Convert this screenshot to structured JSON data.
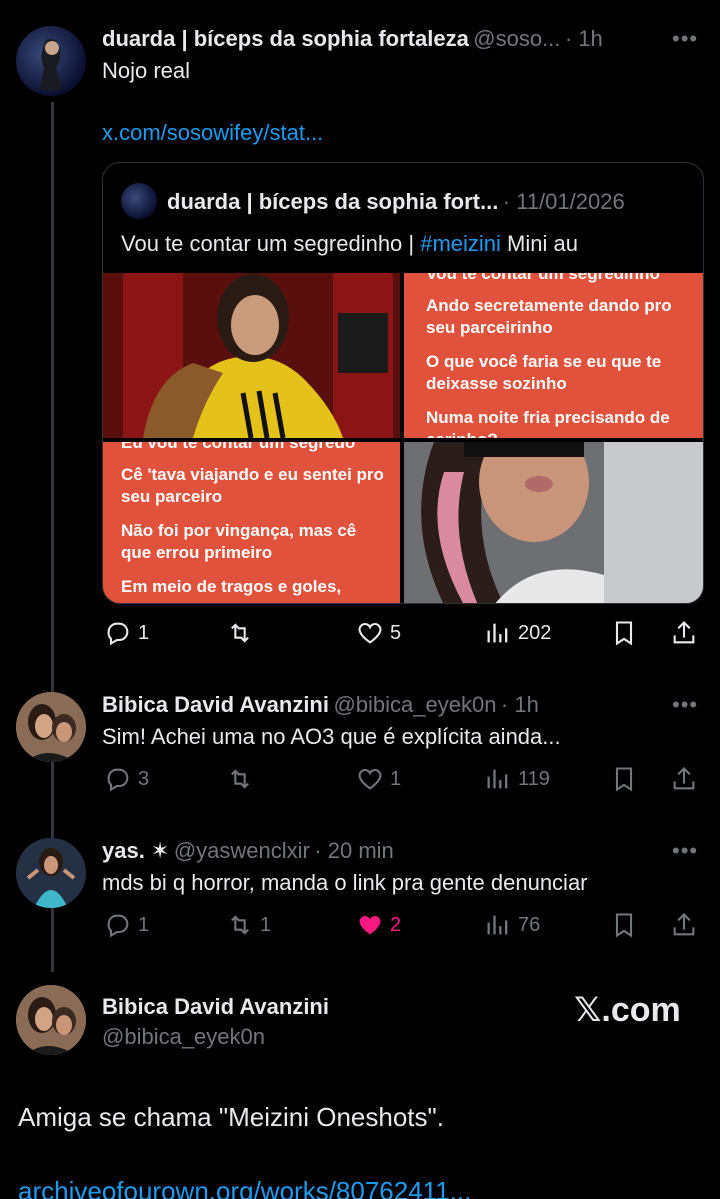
{
  "post1": {
    "name": "duarda | bíceps da sophia fortaleza",
    "handle": "@soso...",
    "time": "· 1h",
    "text": "Nojo real",
    "link": "x.com/sosowifey/stat...",
    "more": "•••",
    "quote": {
      "name": "duarda | bíceps da sophia fort...",
      "date": "· 11/01/2026",
      "text_before": "Vou te contar um segredinho | ",
      "hashtag": "#meizini",
      "text_after": " Mini au",
      "card1": {
        "cut": "Vou te contar um segredinho",
        "l1": "Ando secretamente dando pro seu parceirinho",
        "l2": "O que você faria se eu que te deixasse sozinho",
        "l3": "Numa noite fria precisando de carinho?"
      },
      "card2": {
        "cut": "Eu vou te contar um segredo",
        "l1": "Cê 'tava viajando e eu sentei pro seu parceiro",
        "l2": "Não foi por vingança, mas cê que errou primeiro",
        "l3": "Em meio de tragos e goles,"
      }
    },
    "stats": {
      "replies": "1",
      "reposts": "",
      "likes": "5",
      "views": "202"
    }
  },
  "post2": {
    "name": "Bibica David Avanzini",
    "handle": "@bibica_eyek0n",
    "time": "· 1h",
    "text": "Sim! Achei uma no AO3 que é explícita ainda...",
    "more": "•••",
    "stats": {
      "replies": "3",
      "reposts": "",
      "likes": "1",
      "views": "119"
    }
  },
  "post3": {
    "name": "yas. ✶",
    "handle": "@yaswenclxir",
    "time": "· 20 min",
    "text": "mds bi q horror, manda o link pra gente denunciar",
    "more": "•••",
    "stats": {
      "replies": "1",
      "reposts": "1",
      "likes": "2",
      "views": "76"
    }
  },
  "main": {
    "name": "Bibica David Avanzini",
    "handle": "@bibica_eyek0n",
    "brand": "𝕏.com",
    "text": "Amiga se chama \"Meizini Oneshots\".",
    "link": "archiveofourown.org/works/80762411..."
  },
  "colors": {
    "accent": "#1d9bf0",
    "like": "#f91880",
    "muted": "#71767b",
    "card": "#e0523b"
  }
}
